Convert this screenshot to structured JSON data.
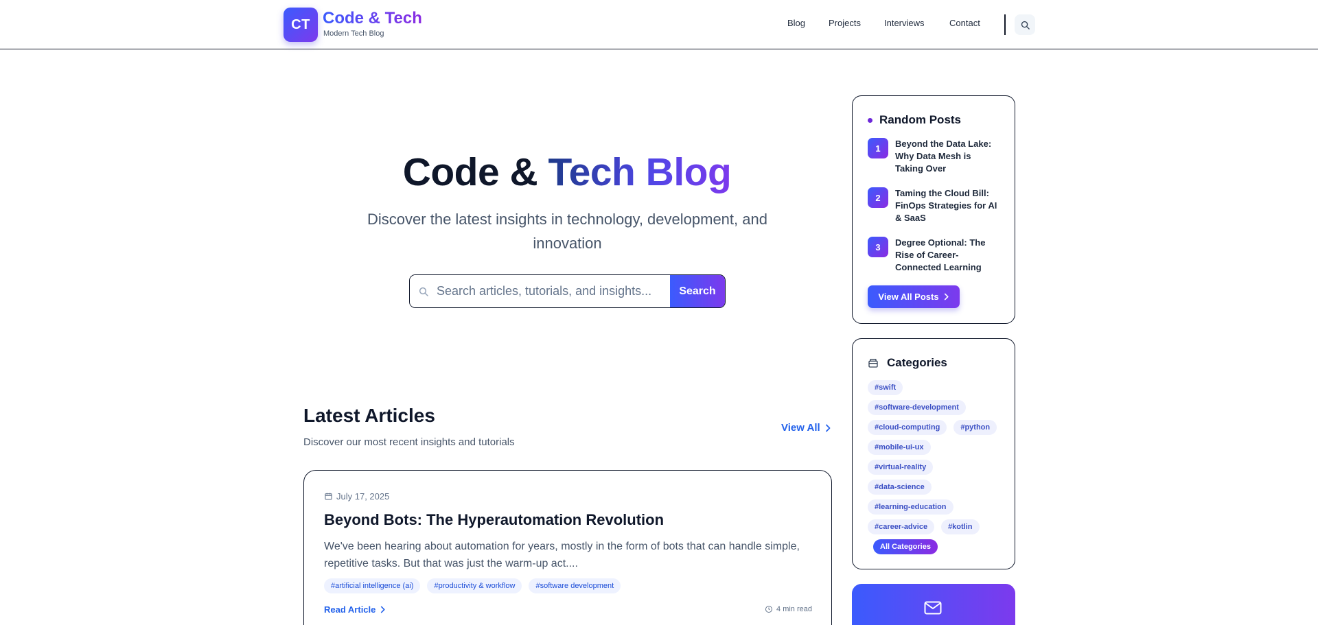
{
  "header": {
    "logo_initials": "CT",
    "brand": "Code & Tech",
    "tagline": "Modern Tech Blog",
    "nav": [
      "Blog",
      "Projects",
      "Interviews",
      "Contact"
    ],
    "search_icon": "search-icon"
  },
  "hero": {
    "title_part1": "Code &",
    "title_part2": "Tech Blog",
    "subtitle": "Discover the latest insights in technology, development, and innovation",
    "search_placeholder": "Search articles, tutorials, and insights...",
    "search_button": "Search"
  },
  "latest": {
    "title": "Latest Articles",
    "subtitle": "Discover our most recent insights and tutorials",
    "view_all": "View All"
  },
  "article": {
    "date": "July 17, 2025",
    "title": "Beyond Bots: The Hyperautomation Revolution",
    "excerpt": "We've been hearing about automation for years, mostly in the form of bots that can handle simple, repetitive tasks. But that was just the warm-up act....",
    "tags": [
      "#artificial intelligence (ai)",
      "#productivity & workflow",
      "#software development"
    ],
    "read_more": "Read Article",
    "read_time": "4 min read"
  },
  "random_posts": {
    "title": "Random Posts",
    "items": [
      {
        "num": "1",
        "title": "Beyond the Data Lake: Why Data Mesh is Taking Over"
      },
      {
        "num": "2",
        "title": "Taming the Cloud Bill: FinOps Strategies for AI & SaaS"
      },
      {
        "num": "3",
        "title": "Degree Optional: The Rise of Career-Connected Learning"
      }
    ],
    "button": "View All Posts"
  },
  "categories": {
    "title": "Categories",
    "chips": [
      "#swift",
      "#software-development",
      "#cloud-computing",
      "#python",
      "#mobile-ui-ux",
      "#virtual-reality",
      "#data-science",
      "#learning-education",
      "#career-advice",
      "#kotlin"
    ],
    "all_button": "All Categories"
  },
  "colors": {
    "accent_start": "#3b5bfd",
    "accent_end": "#7c3aed",
    "link": "#2563eb"
  }
}
